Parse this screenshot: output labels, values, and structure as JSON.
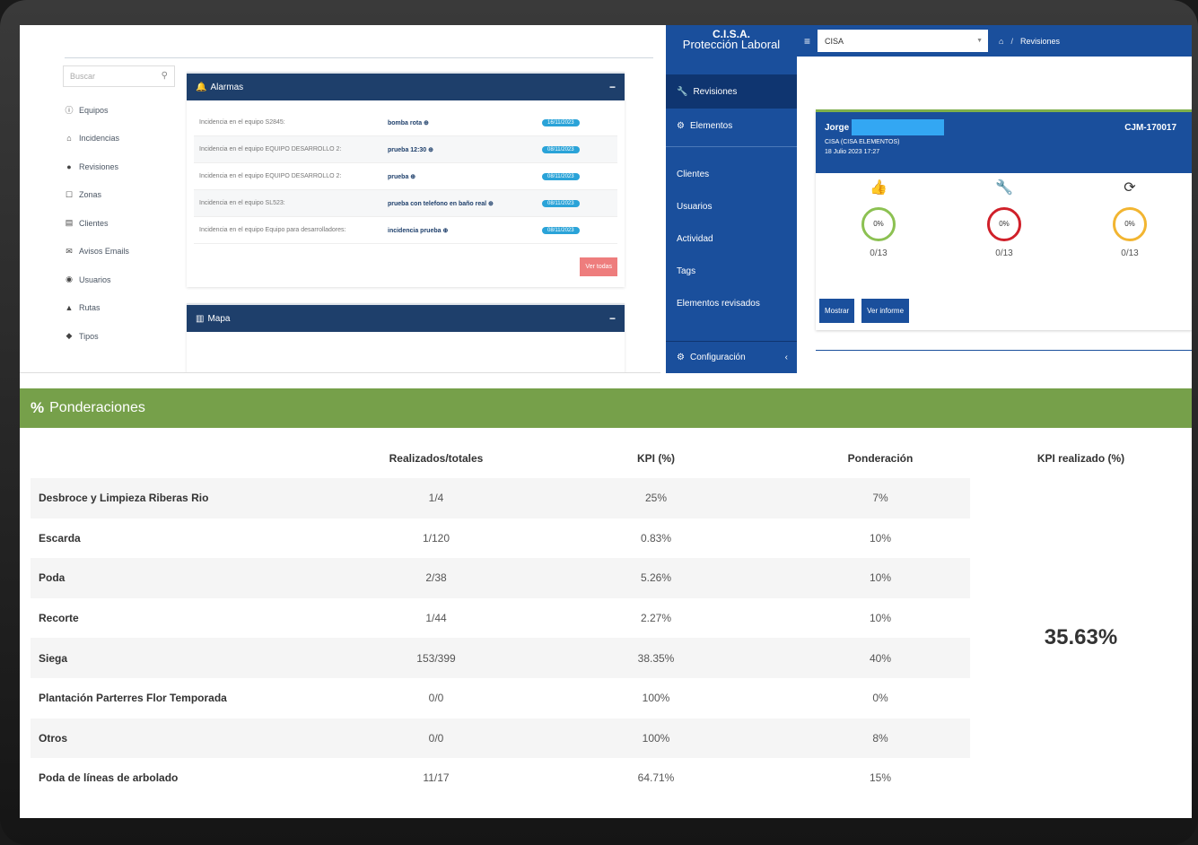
{
  "top_left": {
    "search_placeholder": "Buscar",
    "nav": [
      {
        "icon": "info-icon",
        "glyph": "ⓘ",
        "label": "Equipos"
      },
      {
        "icon": "home-icon",
        "glyph": "⌂",
        "label": "Incidencias"
      },
      {
        "icon": "dot-icon",
        "glyph": "●",
        "label": "Revisiones"
      },
      {
        "icon": "zone-icon",
        "glyph": "☐",
        "label": "Zonas"
      },
      {
        "icon": "clients-icon",
        "glyph": "▤",
        "label": "Clientes"
      },
      {
        "icon": "email-icon",
        "glyph": "✉",
        "label": "Avisos Emails"
      },
      {
        "icon": "user-icon",
        "glyph": "◉",
        "label": "Usuarios"
      },
      {
        "icon": "route-icon",
        "glyph": "▲",
        "label": "Rutas"
      },
      {
        "icon": "tag-icon",
        "glyph": "◆",
        "label": "Tipos"
      }
    ],
    "alarms_title": "Alarmas",
    "alarms": [
      {
        "text": "Incidencia en el equipo S2845:",
        "detail": "bomba rota ⊕",
        "date": "16/11/2023"
      },
      {
        "text": "Incidencia en el equipo EQUIPO DESARROLLO 2:",
        "detail": "prueba 12:30 ⊕",
        "date": "08/11/2023"
      },
      {
        "text": "Incidencia en el equipo EQUIPO DESARROLLO 2:",
        "detail": "prueba ⊕",
        "date": "08/11/2023"
      },
      {
        "text": "Incidencia en el equipo SL523:",
        "detail": "prueba con telefono en baño real ⊕",
        "date": "08/11/2023"
      },
      {
        "text": "Incidencia en el equipo Equipo para desarrolladores:",
        "detail": "incidencia prueba ⊕",
        "date": "08/11/2023"
      }
    ],
    "ver_todas": "Ver todas",
    "mapa_title": "Mapa"
  },
  "top_right": {
    "brand_line1": "C.I.S.A.",
    "brand_line2": "Protección Laboral",
    "select_value": "CISA",
    "breadcrumb_current": "Revisiones",
    "sidebar_active": "Revisiones",
    "sidebar_elementos": "Elementos",
    "sidebar_items": [
      "Clientes",
      "Usuarios",
      "Actividad",
      "Tags",
      "Elementos revisados"
    ],
    "configuracion": "Configuración",
    "card": {
      "name": "Jorge",
      "code": "CJM-170017",
      "company": "CISA (CISA ELEMENTOS)",
      "date": "18 Julio 2023 17:27",
      "stats": [
        {
          "icon": "thumbs-up-icon",
          "glyph": "👍",
          "percent": "0%",
          "count": "0/13",
          "color": "#8cc152"
        },
        {
          "icon": "wrench-icon",
          "glyph": "🔧",
          "percent": "0%",
          "count": "0/13",
          "color": "#d0202a"
        },
        {
          "icon": "refresh-icon",
          "glyph": "⟳",
          "percent": "0%",
          "count": "0/13",
          "color": "#f2b531"
        }
      ],
      "btn_mostrar": "Mostrar",
      "btn_informe": "Ver informe"
    }
  },
  "ponderaciones": {
    "title": "Ponderaciones",
    "headers": [
      "",
      "Realizados/totales",
      "KPI (%)",
      "Ponderación",
      "KPI realizado (%)"
    ],
    "kpi_total": "35.63%",
    "rows": [
      {
        "name": "Desbroce y Limpieza Riberas Rio",
        "done": "1/4",
        "kpi": "25%",
        "weight": "7%"
      },
      {
        "name": "Escarda",
        "done": "1/120",
        "kpi": "0.83%",
        "weight": "10%"
      },
      {
        "name": "Poda",
        "done": "2/38",
        "kpi": "5.26%",
        "weight": "10%"
      },
      {
        "name": "Recorte",
        "done": "1/44",
        "kpi": "2.27%",
        "weight": "10%"
      },
      {
        "name": "Siega",
        "done": "153/399",
        "kpi": "38.35%",
        "weight": "40%"
      },
      {
        "name": "Plantación Parterres Flor Temporada",
        "done": "0/0",
        "kpi": "100%",
        "weight": "0%"
      },
      {
        "name": "Otros",
        "done": "0/0",
        "kpi": "100%",
        "weight": "8%"
      },
      {
        "name": "Poda de líneas de arbolado",
        "done": "11/17",
        "kpi": "64.71%",
        "weight": "15%"
      }
    ]
  }
}
